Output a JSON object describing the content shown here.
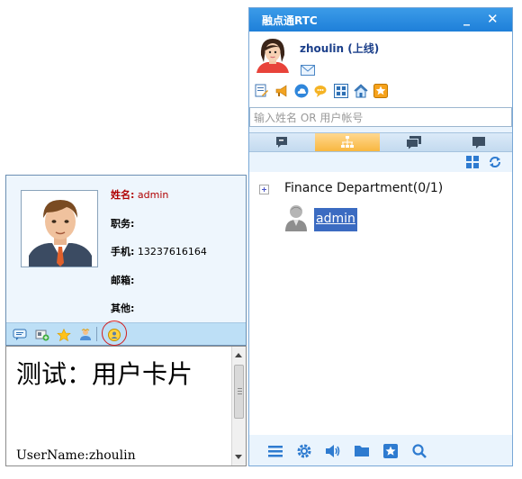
{
  "card": {
    "fields": [
      {
        "label": "姓名:",
        "value": "admin"
      },
      {
        "label": "职务:",
        "value": ""
      },
      {
        "label": "手机:",
        "value": "13237616164"
      },
      {
        "label": "邮箱:",
        "value": ""
      },
      {
        "label": "其他:",
        "value": ""
      }
    ],
    "toolbar_icons": [
      "chat-icon",
      "card-add-icon",
      "star-icon",
      "user-group-icon",
      "user-card-icon"
    ],
    "highlight_color": "#d21c1c"
  },
  "message": {
    "heading": "测试：用户卡片",
    "username_line": "UserName:zhoulin"
  },
  "rtc": {
    "title": "融点通RTC",
    "minimize": "_",
    "close": "✕",
    "profile_name": "zhoulin (上线)",
    "search_placeholder": "输入姓名 OR 用户帐号",
    "tabs": [
      "recent-chats",
      "org-tree",
      "group-chat",
      "discussion"
    ],
    "active_tab": 1,
    "department": "Finance Department(0/1)",
    "member": "admin",
    "accent": "#1e7fd9",
    "bottom_icons": [
      "menu-icon",
      "settings-icon",
      "volume-icon",
      "folder-icon",
      "star-box-icon",
      "search-icon"
    ]
  }
}
